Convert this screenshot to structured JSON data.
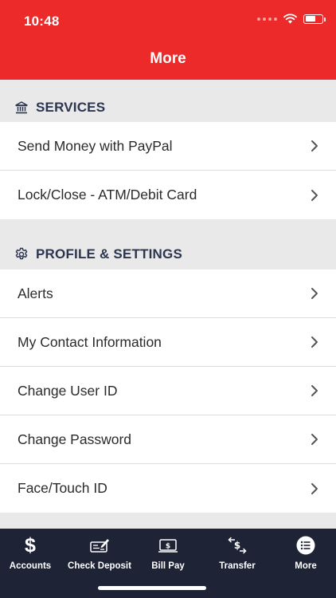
{
  "status_bar": {
    "time": "10:48"
  },
  "header": {
    "title": "More"
  },
  "sections": [
    {
      "title": "SERVICES",
      "icon": "bank-icon",
      "items": [
        {
          "label": "Send Money with PayPal"
        },
        {
          "label": "Lock/Close - ATM/Debit Card"
        }
      ]
    },
    {
      "title": "PROFILE & SETTINGS",
      "icon": "gear-icon",
      "items": [
        {
          "label": "Alerts"
        },
        {
          "label": "My Contact Information"
        },
        {
          "label": "Change User ID"
        },
        {
          "label": "Change Password"
        },
        {
          "label": "Face/Touch ID"
        }
      ]
    }
  ],
  "tabbar": {
    "tabs": [
      {
        "label": "Accounts",
        "icon": "dollar-icon"
      },
      {
        "label": "Check Deposit",
        "icon": "check-deposit-icon"
      },
      {
        "label": "Bill Pay",
        "icon": "bill-pay-icon"
      },
      {
        "label": "Transfer",
        "icon": "transfer-icon"
      },
      {
        "label": "More",
        "icon": "menu-list-icon",
        "selected": true
      }
    ]
  },
  "colors": {
    "brand_red": "#ec2a2a",
    "tabbar_navy": "#1e2436",
    "section_text": "#2c3550",
    "background": "#e9e9e9"
  }
}
